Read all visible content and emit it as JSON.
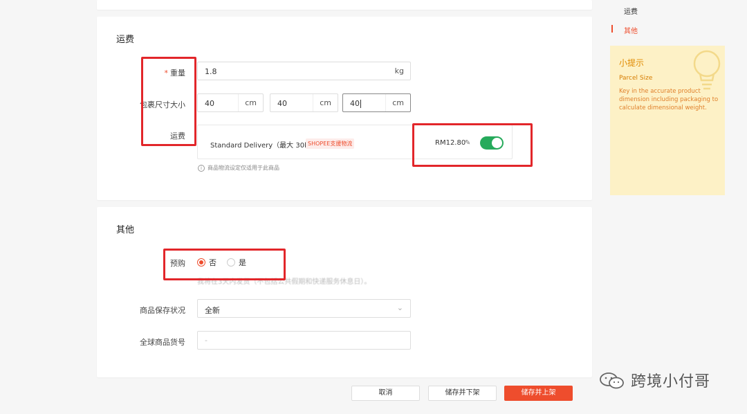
{
  "shipping": {
    "title": "运费",
    "weight_label": "重量",
    "weight_required": "*",
    "weight_value": "1.8",
    "weight_unit": "kg",
    "size_label": "包裹尺寸大小",
    "dims": [
      {
        "value": "40",
        "unit": "cm"
      },
      {
        "value": "40",
        "unit": "cm"
      },
      {
        "value": "40",
        "unit": "cm"
      }
    ],
    "fee_label": "运费",
    "method_name": "Standard Delivery（最大 30kg）",
    "method_tag": "SHOPEE支援物流",
    "price": "RM12.80",
    "toggle_on": true,
    "hint": "商品物流设定仅适用于此商品"
  },
  "other": {
    "title": "其他",
    "preorder_label": "预购",
    "preorder_options": [
      "否",
      "是"
    ],
    "preorder_selected": "否",
    "preorder_note": "我将在3天内发货（不包括公共假期和快递服务休息日）。",
    "condition_label": "商品保存状况",
    "condition_value": "全新",
    "sku_label": "全球商品货号",
    "sku_placeholder": "-"
  },
  "buttons": {
    "cancel": "取消",
    "save_unlist": "储存并下架",
    "save_list": "储存并上架"
  },
  "sidebar": {
    "items": [
      {
        "label": "运费",
        "active": false
      },
      {
        "label": "其他",
        "active": true
      }
    ]
  },
  "tip": {
    "title": "小提示",
    "subtitle": "Parcel Size",
    "body": "Key in the accurate product dimension including packaging to calculate dimensional weight."
  },
  "watermark": "跨境小付哥",
  "colors": {
    "accent": "#ee4d2d",
    "toggle": "#26aa5b",
    "annotation": "#e2262a",
    "tip_bg": "#fdf1c6"
  }
}
